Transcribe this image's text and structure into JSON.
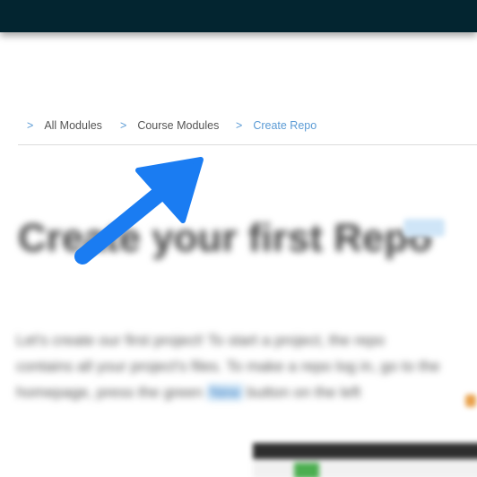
{
  "header": {
    "background_color": "#032530"
  },
  "breadcrumb": {
    "separator": ">",
    "items": [
      {
        "label": "All Modules"
      },
      {
        "label": "Course Modules"
      },
      {
        "label": "Create Repo"
      }
    ]
  },
  "page": {
    "title": "Create your first Repo",
    "paragraph": {
      "line1": "Let's create our first project! To start a project, the repo",
      "line2": "contains all your project's files. To make a repo log in, go to the",
      "line3_before": "homepage, press the green",
      "line3_button": "New",
      "line3_after": "button on the left"
    }
  },
  "annotation": {
    "icon": "arrow-pointer-icon",
    "color": "#1a7cf2"
  }
}
